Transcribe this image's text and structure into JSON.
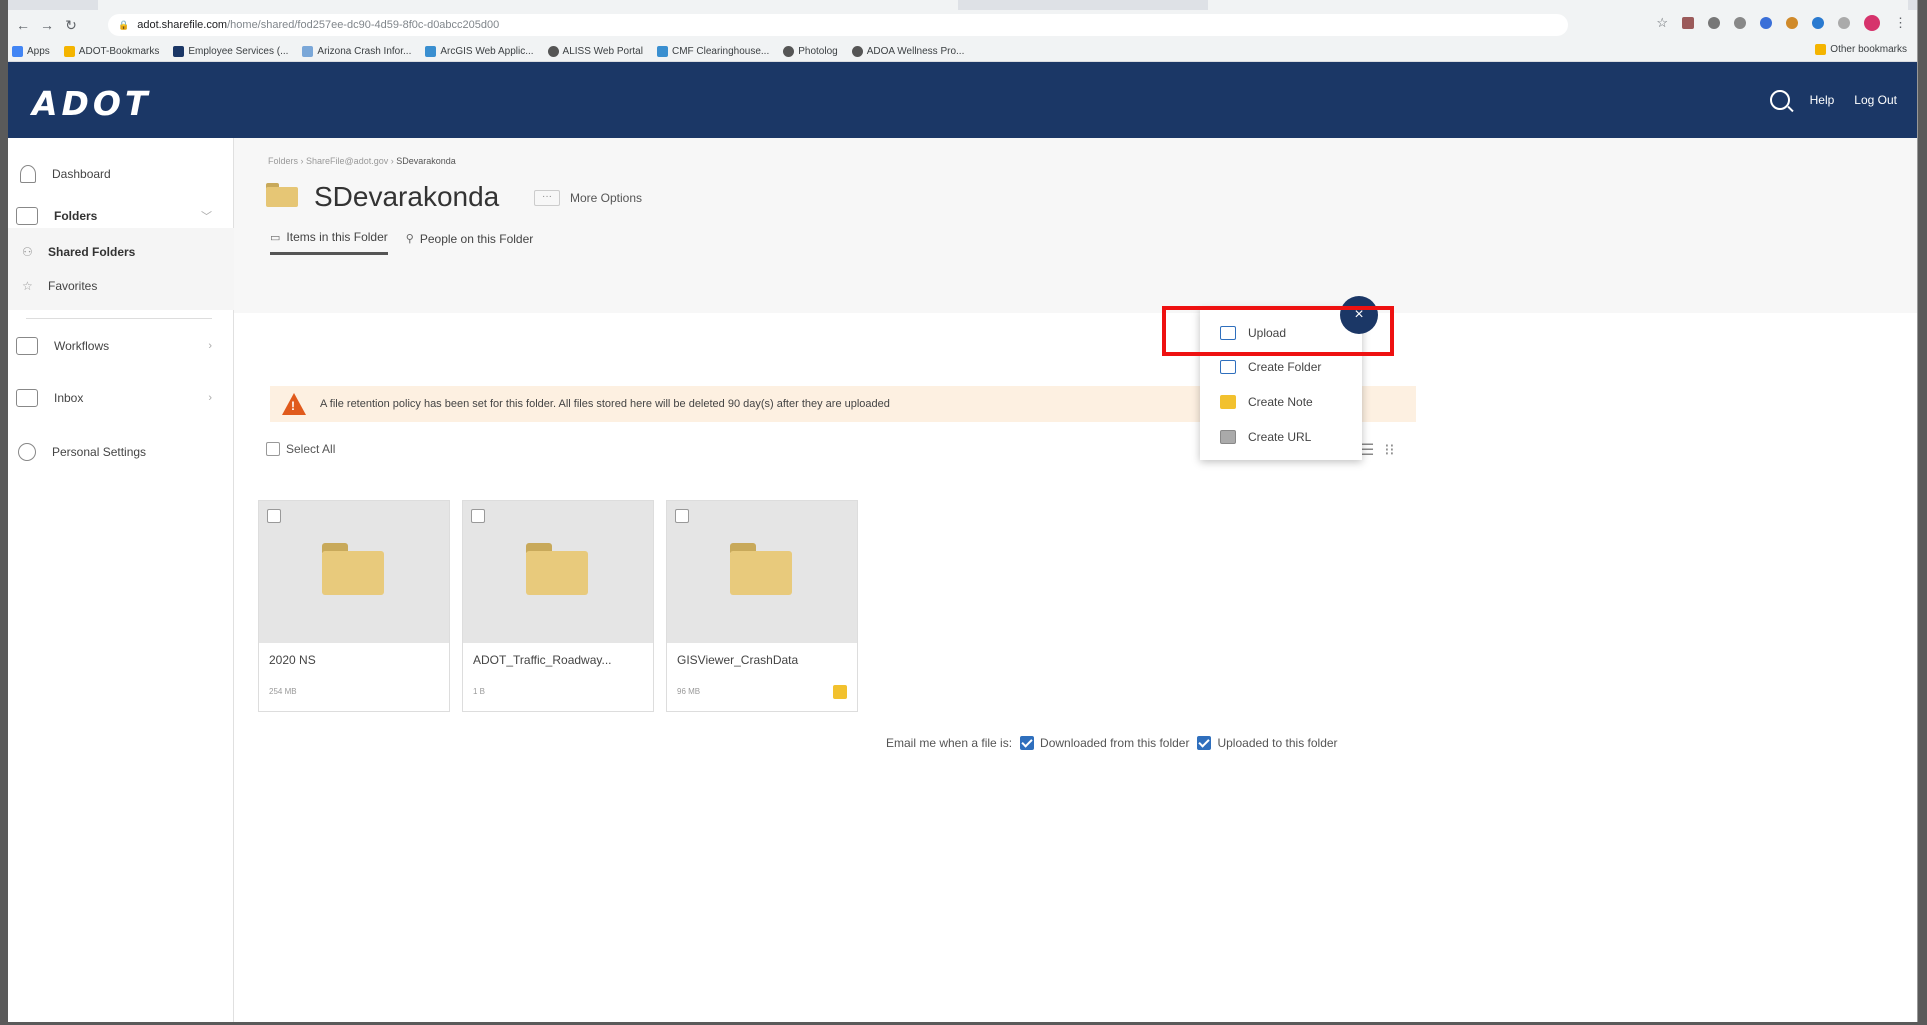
{
  "browser": {
    "url_host": "adot.sharefile.com",
    "url_path": "/home/shared/fod257ee-dc90-4d59-8f0c-d0abcc205d00",
    "bookmarks": [
      {
        "label": "Apps",
        "color": "#4285f4"
      },
      {
        "label": "ADOT-Bookmarks",
        "color": "#f4b400"
      },
      {
        "label": "Employee Services (...",
        "color": "#1b3766"
      },
      {
        "label": "Arizona Crash Infor...",
        "color": "#7aa7d8"
      },
      {
        "label": "ArcGIS Web Applic...",
        "color": "#3a8fd0"
      },
      {
        "label": "ALISS Web Portal",
        "color": "#555555"
      },
      {
        "label": "CMF Clearinghouse...",
        "color": "#3a8fd0"
      },
      {
        "label": "Photolog",
        "color": "#555555"
      },
      {
        "label": "ADOA Wellness Pro...",
        "color": "#555555"
      }
    ],
    "other_bookmarks": "Other bookmarks"
  },
  "header": {
    "logo": "ADOT",
    "help": "Help",
    "logout": "Log Out",
    "bg": "#1b3766"
  },
  "sidebar": {
    "dashboard": "Dashboard",
    "folders": "Folders",
    "shared_folders": "Shared Folders",
    "favorites": "Favorites",
    "workflows": "Workflows",
    "inbox": "Inbox",
    "personal_settings": "Personal Settings"
  },
  "main": {
    "breadcrumb": {
      "root": "Folders",
      "parent": "ShareFile@adot.gov",
      "current": "SDevarakonda"
    },
    "title": "SDevarakonda",
    "more_options": "More Options",
    "tabs": {
      "items": "Items in this Folder",
      "people": "People on this Folder"
    },
    "notice": "A file retention policy has been set for this folder. All files stored here will be deleted 90 day(s) after they are uploaded",
    "select_all": "Select All",
    "items": [
      {
        "name": "2020 NS",
        "size": "254 MB"
      },
      {
        "name": "ADOT_Traffic_Roadway...",
        "size": "1 B"
      },
      {
        "name": "GISViewer_CrashData",
        "size": "96 MB"
      }
    ],
    "email": {
      "label": "Email me when a file is:",
      "downloaded": "Downloaded from this folder",
      "uploaded": "Uploaded to this folder"
    }
  },
  "menu": {
    "close": "×",
    "upload": "Upload",
    "create_folder": "Create Folder",
    "create_note": "Create Note",
    "create_url": "Create URL"
  }
}
